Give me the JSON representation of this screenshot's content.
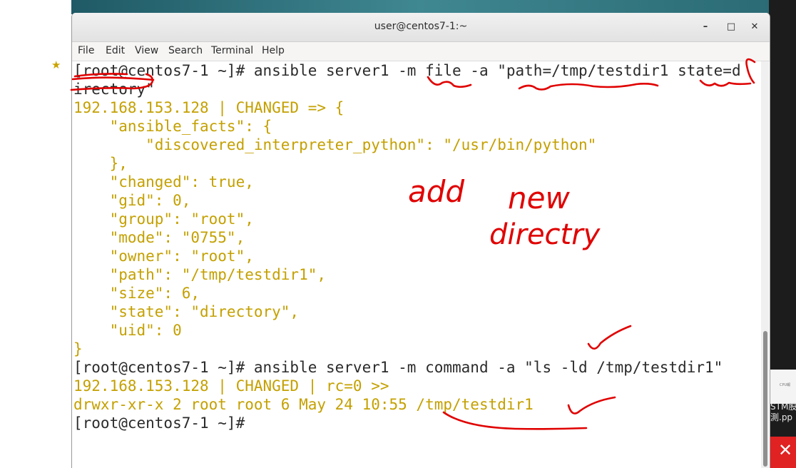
{
  "window": {
    "title": "user@centos7-1:~",
    "buttons": {
      "minimize": "–",
      "maximize": "□",
      "close": "✕"
    }
  },
  "menu": [
    "File",
    "Edit",
    "View",
    "Search",
    "Terminal",
    "Help"
  ],
  "terminal": {
    "lines": [
      {
        "kind": "cmd",
        "text": "[root@centos7-1 ~]# ansible server1 -m file -a \"path=/tmp/testdir1 state=d"
      },
      {
        "kind": "cmd",
        "text": "irectory\""
      },
      {
        "kind": "out",
        "text": "192.168.153.128 | CHANGED => {"
      },
      {
        "kind": "out",
        "text": "    \"ansible_facts\": {"
      },
      {
        "kind": "out",
        "text": "        \"discovered_interpreter_python\": \"/usr/bin/python\""
      },
      {
        "kind": "out",
        "text": "    },"
      },
      {
        "kind": "out",
        "text": "    \"changed\": true,"
      },
      {
        "kind": "out",
        "text": "    \"gid\": 0,"
      },
      {
        "kind": "out",
        "text": "    \"group\": \"root\","
      },
      {
        "kind": "out",
        "text": "    \"mode\": \"0755\","
      },
      {
        "kind": "out",
        "text": "    \"owner\": \"root\","
      },
      {
        "kind": "out",
        "text": "    \"path\": \"/tmp/testdir1\","
      },
      {
        "kind": "out",
        "text": "    \"size\": 6,"
      },
      {
        "kind": "out",
        "text": "    \"state\": \"directory\","
      },
      {
        "kind": "out",
        "text": "    \"uid\": 0"
      },
      {
        "kind": "out",
        "text": "}"
      },
      {
        "kind": "cmd",
        "text": "[root@centos7-1 ~]# ansible server1 -m command -a \"ls -ld /tmp/testdir1\""
      },
      {
        "kind": "out",
        "text": "192.168.153.128 | CHANGED | rc=0 >>"
      },
      {
        "kind": "out",
        "text": "drwxr-xr-x 2 root root 6 May 24 10:55 /tmp/testdir1"
      },
      {
        "kind": "cmd",
        "text": "[root@centos7-1 ~]#"
      }
    ]
  },
  "annotations": {
    "line1": "add",
    "line2": "new",
    "line3": "directry"
  },
  "side_panel": {
    "thumb_text": "STM股\n測.pp",
    "mini_label": "CPU報"
  },
  "colors": {
    "prompt": "#2b2b2b",
    "output": "#c4a000",
    "ink": "#e00000"
  },
  "icons": {
    "star": "star-icon",
    "close": "close-icon"
  }
}
